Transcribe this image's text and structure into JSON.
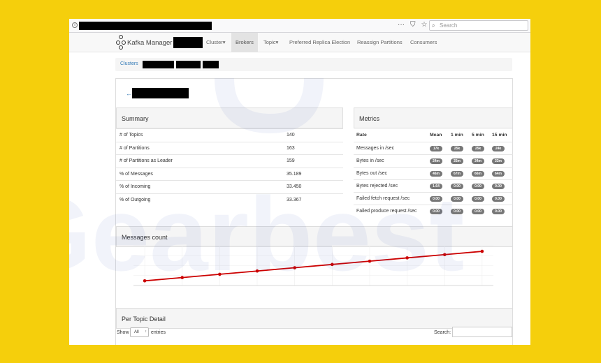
{
  "browser": {
    "search_placeholder": "Search",
    "actions": [
      "···",
      "⛉",
      "☆"
    ]
  },
  "navbar": {
    "brand": "Kafka Manager",
    "items": [
      {
        "label": "Cluster",
        "caret": "▾"
      },
      {
        "label": "Brokers"
      },
      {
        "label": "Topic",
        "caret": "▾"
      },
      {
        "label": "Preferred Replica Election"
      },
      {
        "label": "Reassign Partitions"
      },
      {
        "label": "Consumers"
      }
    ]
  },
  "breadcrumb": {
    "root": "Clusters"
  },
  "page": {
    "back_arrow": "←"
  },
  "summary": {
    "title": "Summary",
    "rows": [
      {
        "label": "# of Topics",
        "value": "140"
      },
      {
        "label": "# of Partitions",
        "value": "163"
      },
      {
        "label": "# of Partitions as Leader",
        "value": "159"
      },
      {
        "label": "% of Messages",
        "value": "35.189"
      },
      {
        "label": "% of Incoming",
        "value": "33.450"
      },
      {
        "label": "% of Outgoing",
        "value": "33.367"
      }
    ]
  },
  "metrics": {
    "title": "Metrics",
    "headers": [
      "Rate",
      "Mean",
      "1 min",
      "5 min",
      "15 min"
    ],
    "rows": [
      {
        "label": "Messages in /sec",
        "values": [
          "17k",
          "25k",
          "25k",
          "24k"
        ]
      },
      {
        "label": "Bytes in /sec",
        "values": [
          "24m",
          "35m",
          "34m",
          "33m"
        ]
      },
      {
        "label": "Bytes out /sec",
        "values": [
          "46m",
          "67m",
          "66m",
          "64m"
        ]
      },
      {
        "label": "Bytes rejected /sec",
        "values": [
          "1.64",
          "0.00",
          "0.00",
          "0.00"
        ]
      },
      {
        "label": "Failed fetch request /sec",
        "values": [
          "0.00",
          "0.00",
          "0.00",
          "0.00"
        ]
      },
      {
        "label": "Failed produce request /sec",
        "values": [
          "0.00",
          "0.00",
          "0.00",
          "0.00"
        ]
      }
    ]
  },
  "messages_count": {
    "title": "Messages count"
  },
  "chart_data": {
    "type": "line",
    "x": [
      1,
      2,
      3,
      4,
      5,
      6,
      7,
      8,
      9,
      10
    ],
    "series": [
      {
        "values": [
          1.0,
          1.7,
          2.4,
          3.1,
          3.8,
          4.5,
          5.2,
          5.9,
          6.6,
          7.3
        ]
      }
    ],
    "ylim": [
      0,
      8.5
    ],
    "grid": true,
    "color": "#cc0000"
  },
  "per_topic": {
    "title": "Per Topic Detail",
    "show": "Show",
    "select_value": "All",
    "entries": "entries",
    "search": "Search:"
  },
  "watermark": {
    "text": "Gearbest"
  }
}
